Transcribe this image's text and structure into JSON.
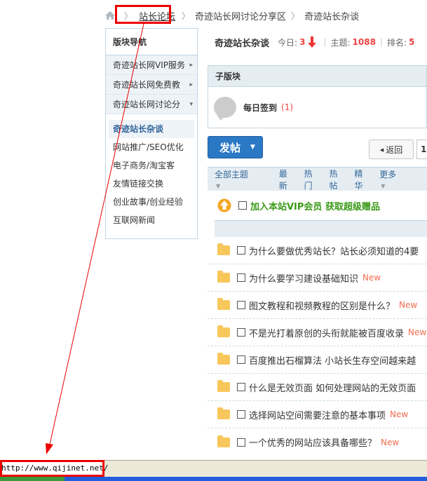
{
  "breadcrumb": {
    "home_icon": "home-icon",
    "items": [
      "站长论坛",
      "奇迹站长网讨论分享区",
      "奇迹站长杂谈"
    ]
  },
  "sidebar": {
    "title": "版块导航",
    "categories": [
      {
        "label": "奇迹站长网VIP服务",
        "arrow": "▸"
      },
      {
        "label": "奇迹站长网免费教",
        "arrow": "▸"
      },
      {
        "label": "奇迹站长网讨论分",
        "arrow": "▾"
      }
    ],
    "links": [
      "奇迹站长杂谈",
      "网站推广/SEO优化",
      "电子商务/淘宝客",
      "友情链接交换",
      "创业故事/创业经验",
      "互联网新闻"
    ]
  },
  "forum_header": {
    "name": "奇迹站长杂谈",
    "today_label": "今日:",
    "today_value": "3",
    "topics_label": "主题:",
    "topics_value": "1088",
    "rank_label": "排名:",
    "rank_value": "5"
  },
  "subforum": {
    "title": "子版块",
    "item_name": "每日签到",
    "item_count": "(1)"
  },
  "toolbar": {
    "post_label": "发帖",
    "back_label": "返回",
    "back_arrow": "◂",
    "page": "1"
  },
  "filter": {
    "all": "全部主题",
    "items": [
      "最新",
      "热门",
      "热帖",
      "精华",
      "更多"
    ]
  },
  "sticky": {
    "title": "加入本站VIP会员 获取超级赠品"
  },
  "threads": [
    {
      "title": "为什么要做优秀站长？站长必须知道的4要",
      "new": ""
    },
    {
      "title": "为什么要学习建设基础知识",
      "new": "New"
    },
    {
      "title": "图文教程和视频教程的区别是什么？",
      "new": "New"
    },
    {
      "title": "不是光打着原创的头衔就能被百度收录",
      "new": "New"
    },
    {
      "title": "百度推出石榴算法 小站长生存空间越来越",
      "new": ""
    },
    {
      "title": "什么是无效页面 如何处理网站的无效页面",
      "new": ""
    },
    {
      "title": "选择网站空间需要注意的基本事项",
      "new": "New"
    },
    {
      "title": "一个优秀的网站应该具备哪些？",
      "new": "New"
    }
  ],
  "statusbar": {
    "url": "http://www.qijinet.net/"
  },
  "colors": {
    "accent_blue": "#2b78c5",
    "highlight_red": "#e00000",
    "sticky_green": "#3a9a17",
    "new_orange": "#f26c4f"
  }
}
